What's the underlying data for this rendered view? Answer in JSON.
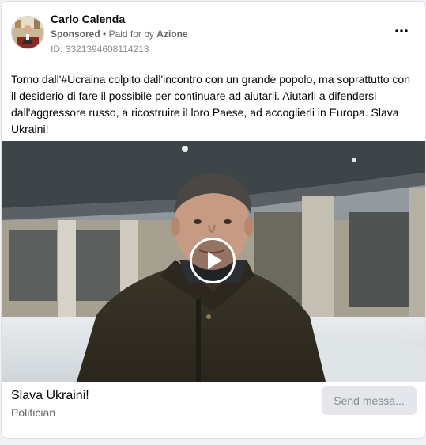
{
  "post": {
    "page_name": "Carlo Calenda",
    "sponsored_label": "Sponsored",
    "separator": "•",
    "paid_for_prefix": "Paid for by",
    "paid_for_entity": "Azione",
    "ad_id": "ID: 3321394608114213",
    "more_icon": "more-horizontal-icon",
    "message": "Torno dall'#Ucraina colpito dall'incontro con un grande popolo, ma soprattutto con il desiderio di fare il possibile per continuare ad aiutarli. Aiutarli a difendersi dall'aggressore russo, a ricostruire il loro Paese, ad accoglierli in Europa. Slava Ukraini!",
    "media": {
      "type": "video",
      "play_icon": "play-icon"
    },
    "cta": {
      "title": "Slava Ukraini!",
      "subtitle": "Politician",
      "button_label": "Send messa..."
    }
  },
  "colors": {
    "secondary_text": "#65676b",
    "button_bg": "#e4e6eb",
    "button_text": "#8a8d91"
  }
}
